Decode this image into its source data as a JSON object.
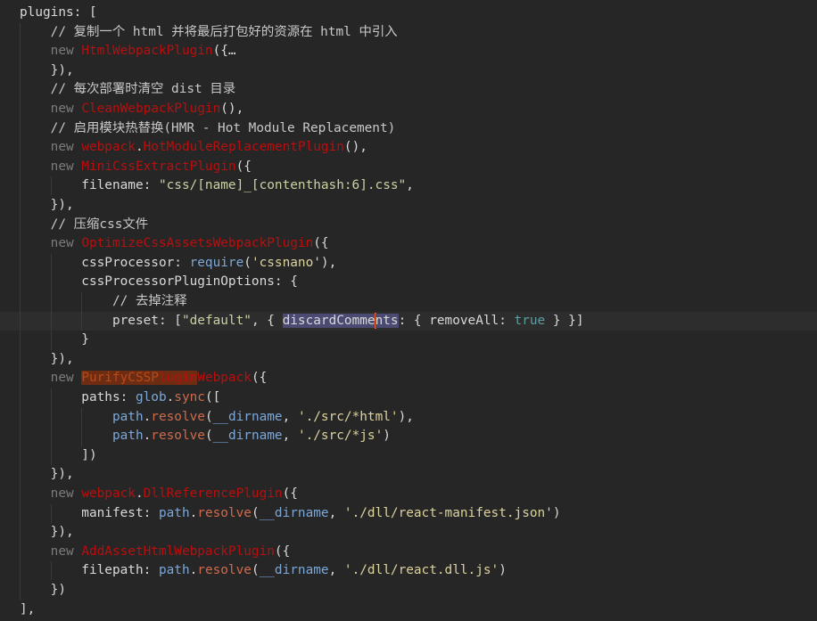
{
  "editor": {
    "lines": [
      {
        "t": [
          [
            "plain",
            "plugins: ["
          ]
        ]
      },
      {
        "t": [
          [
            "cm",
            "    // 复制一个 html 并将最后打包好的资源在 html 中引入"
          ]
        ]
      },
      {
        "t": [
          [
            "kw",
            "    new "
          ],
          [
            "cls",
            "HtmlWebpackPlugin"
          ],
          [
            "plain",
            "({…"
          ]
        ]
      },
      {
        "t": [
          [
            "plain",
            "    }),"
          ]
        ]
      },
      {
        "t": [
          [
            "cm",
            "    // 每次部署时清空 dist 目录"
          ]
        ]
      },
      {
        "t": [
          [
            "kw",
            "    new "
          ],
          [
            "cls",
            "CleanWebpackPlugin"
          ],
          [
            "plain",
            "(),"
          ]
        ]
      },
      {
        "t": [
          [
            "cm",
            "    // 启用模块热替换(HMR - Hot Module Replacement)"
          ]
        ]
      },
      {
        "t": [
          [
            "kw",
            "    new "
          ],
          [
            "cls",
            "webpack"
          ],
          [
            "plain",
            "."
          ],
          [
            "cls",
            "HotModuleReplacementPlugin"
          ],
          [
            "plain",
            "(),"
          ]
        ]
      },
      {
        "t": [
          [
            "kw",
            "    new "
          ],
          [
            "cls",
            "MiniCssExtractPlugin"
          ],
          [
            "plain",
            "({"
          ]
        ]
      },
      {
        "t": [
          [
            "plain",
            "        filename: "
          ],
          [
            "str",
            "\"css/[name]_[contenthash:6].css\""
          ],
          [
            "plain",
            ","
          ]
        ]
      },
      {
        "t": [
          [
            "plain",
            "    }),"
          ]
        ]
      },
      {
        "t": [
          [
            "cm",
            "    // 压缩css文件"
          ]
        ]
      },
      {
        "t": [
          [
            "kw",
            "    new "
          ],
          [
            "cls",
            "OptimizeCssAssetsWebpackPlugin"
          ],
          [
            "plain",
            "({"
          ]
        ]
      },
      {
        "t": [
          [
            "plain",
            "        cssProcessor: "
          ],
          [
            "path",
            "require"
          ],
          [
            "plain",
            "("
          ],
          [
            "str2",
            "'cssnano'"
          ],
          [
            "plain",
            "),"
          ]
        ]
      },
      {
        "t": [
          [
            "plain",
            "        cssProcessorPluginOptions: {"
          ]
        ]
      },
      {
        "t": [
          [
            "cm",
            "            // 去掉注释"
          ]
        ]
      },
      {
        "current": true,
        "t": [
          [
            "plain",
            "            preset: ["
          ],
          [
            "str",
            "\"default\""
          ],
          [
            "plain",
            ", { "
          ],
          [
            "sel",
            "discardComme"
          ],
          [
            "caret",
            ""
          ],
          [
            "sel",
            "nts"
          ],
          [
            "plain",
            ": { removeAll: "
          ],
          [
            "bool",
            "true"
          ],
          [
            "plain",
            " } }]"
          ]
        ]
      },
      {
        "t": [
          [
            "plain",
            "        }"
          ]
        ]
      },
      {
        "t": [
          [
            "plain",
            "    }),"
          ]
        ]
      },
      {
        "t": [
          [
            "kw",
            "    new "
          ],
          [
            "hl",
            "PurifyCSSP"
          ],
          [
            "hlcls",
            "lugin"
          ],
          [
            "cls",
            "Webpack"
          ],
          [
            "plain",
            "({"
          ]
        ]
      },
      {
        "t": [
          [
            "plain",
            "        paths: "
          ],
          [
            "path",
            "glob"
          ],
          [
            "plain",
            "."
          ],
          [
            "fn",
            "sync"
          ],
          [
            "plain",
            "(["
          ]
        ]
      },
      {
        "t": [
          [
            "plain",
            "            "
          ],
          [
            "path",
            "path"
          ],
          [
            "plain",
            "."
          ],
          [
            "fn",
            "resolve"
          ],
          [
            "plain",
            "("
          ],
          [
            "path",
            "__dirname"
          ],
          [
            "plain",
            ", "
          ],
          [
            "str2",
            "'./src/*html'"
          ],
          [
            "plain",
            "),"
          ]
        ]
      },
      {
        "t": [
          [
            "plain",
            "            "
          ],
          [
            "path",
            "path"
          ],
          [
            "plain",
            "."
          ],
          [
            "fn",
            "resolve"
          ],
          [
            "plain",
            "("
          ],
          [
            "path",
            "__dirname"
          ],
          [
            "plain",
            ", "
          ],
          [
            "str2",
            "'./src/*js'"
          ],
          [
            "plain",
            ")"
          ]
        ]
      },
      {
        "t": [
          [
            "plain",
            "        ])"
          ]
        ]
      },
      {
        "t": [
          [
            "plain",
            "    }),"
          ]
        ]
      },
      {
        "t": [
          [
            "kw",
            "    new "
          ],
          [
            "cls",
            "webpack"
          ],
          [
            "plain",
            "."
          ],
          [
            "cls",
            "DllReferencePlugin"
          ],
          [
            "plain",
            "({"
          ]
        ]
      },
      {
        "t": [
          [
            "plain",
            "        manifest: "
          ],
          [
            "path",
            "path"
          ],
          [
            "plain",
            "."
          ],
          [
            "fn",
            "resolve"
          ],
          [
            "plain",
            "("
          ],
          [
            "path",
            "__dirname"
          ],
          [
            "plain",
            ", "
          ],
          [
            "str2",
            "'./dll/react-manifest.json'"
          ],
          [
            "plain",
            ")"
          ]
        ]
      },
      {
        "t": [
          [
            "plain",
            "    }),"
          ]
        ]
      },
      {
        "t": [
          [
            "kw",
            "    new "
          ],
          [
            "cls",
            "AddAssetHtmlWebpackPlugin"
          ],
          [
            "plain",
            "({"
          ]
        ]
      },
      {
        "t": [
          [
            "plain",
            "        filepath: "
          ],
          [
            "path",
            "path"
          ],
          [
            "plain",
            "."
          ],
          [
            "fn",
            "resolve"
          ],
          [
            "plain",
            "("
          ],
          [
            "path",
            "__dirname"
          ],
          [
            "plain",
            ", "
          ],
          [
            "str2",
            "'./dll/react.dll.js'"
          ],
          [
            "plain",
            ")"
          ]
        ]
      },
      {
        "t": [
          [
            "plain",
            "    })"
          ]
        ]
      },
      {
        "t": [
          [
            "plain",
            "],"
          ]
        ]
      }
    ]
  }
}
